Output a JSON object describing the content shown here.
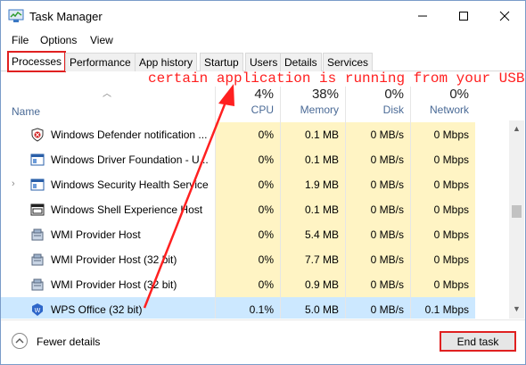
{
  "window": {
    "title": "Task Manager"
  },
  "menu": [
    "File",
    "Options",
    "View"
  ],
  "tabs": [
    "Processes",
    "Performance",
    "App history",
    "Startup",
    "Users",
    "Details",
    "Services"
  ],
  "annotation": "certain application is running from your USB",
  "columns": {
    "name": "Name",
    "cpu": {
      "pct": "4%",
      "label": "CPU"
    },
    "memory": {
      "pct": "38%",
      "label": "Memory"
    },
    "disk": {
      "pct": "0%",
      "label": "Disk"
    },
    "network": {
      "pct": "0%",
      "label": "Network"
    }
  },
  "rows": [
    {
      "name": "Windows Defender notification ...",
      "icon": "shield-icon",
      "cpu": "0%",
      "memory": "0.1 MB",
      "disk": "0 MB/s",
      "network": "0 Mbps"
    },
    {
      "name": "Windows Driver Foundation - U...",
      "icon": "window-icon",
      "cpu": "0%",
      "memory": "0.1 MB",
      "disk": "0 MB/s",
      "network": "0 Mbps"
    },
    {
      "name": "Windows Security Health Service",
      "icon": "window-icon",
      "cpu": "0%",
      "memory": "1.9 MB",
      "disk": "0 MB/s",
      "network": "0 Mbps"
    },
    {
      "name": "Windows Shell Experience Host",
      "icon": "app-window-icon",
      "cpu": "0%",
      "memory": "0.1 MB",
      "disk": "0 MB/s",
      "network": "0 Mbps"
    },
    {
      "name": "WMI Provider Host",
      "icon": "wmi-icon",
      "cpu": "0%",
      "memory": "5.4 MB",
      "disk": "0 MB/s",
      "network": "0 Mbps"
    },
    {
      "name": "WMI Provider Host (32 bit)",
      "icon": "wmi-icon",
      "cpu": "0%",
      "memory": "7.7 MB",
      "disk": "0 MB/s",
      "network": "0 Mbps"
    },
    {
      "name": "WMI Provider Host (32 bit)",
      "icon": "wmi-icon",
      "cpu": "0%",
      "memory": "0.9 MB",
      "disk": "0 MB/s",
      "network": "0 Mbps"
    },
    {
      "name": "WPS Office (32 bit)",
      "icon": "wps-icon",
      "cpu": "0.1%",
      "memory": "5.0 MB",
      "disk": "0 MB/s",
      "network": "0.1 Mbps"
    }
  ],
  "footer": {
    "fewer_details": "Fewer details",
    "end_task": "End task"
  },
  "colors": {
    "highlight": "#e02020",
    "heat": "#fff4c4",
    "selected": "#cce8ff",
    "header_text": "#4a6a96"
  }
}
